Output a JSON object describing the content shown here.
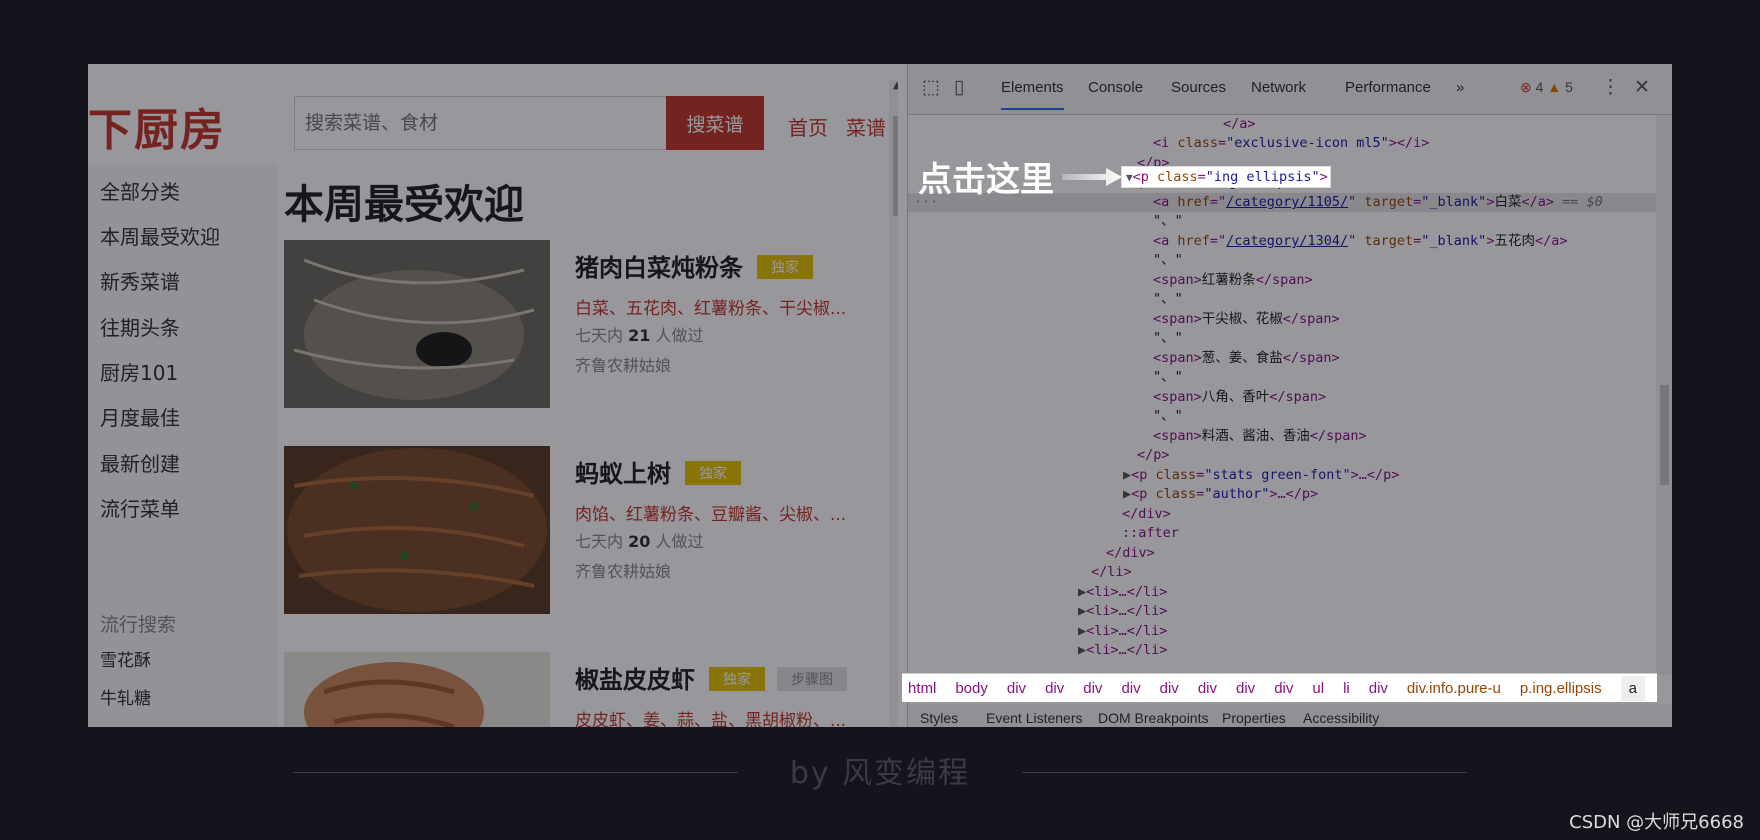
{
  "site": {
    "logo": "下厨房",
    "search_placeholder": "搜索菜谱、食材",
    "search_button": "搜菜谱",
    "nav": [
      "首页",
      "菜谱"
    ]
  },
  "sidebar": {
    "items": [
      "全部分类",
      "本周最受欢迎",
      "新秀菜谱",
      "往期头条",
      "厨房101",
      "月度最佳",
      "最新创建",
      "流行菜单"
    ],
    "popular_title": "流行搜索",
    "popular": [
      "雪花酥",
      "牛轧糖"
    ]
  },
  "main": {
    "title": "本周最受欢迎",
    "recipes": [
      {
        "name": "猪肉白菜炖粉条",
        "badge": "独家",
        "ingredients": "白菜、五花肉、红薯粉条、干尖椒...",
        "stats_prefix": "七天内",
        "stats_count": "21",
        "stats_suffix": "人做过",
        "author": "齐鲁农耕姑娘"
      },
      {
        "name": "蚂蚁上树",
        "badge": "独家",
        "ingredients": "肉馅、红薯粉条、豆瓣酱、尖椒、...",
        "stats_prefix": "七天内",
        "stats_count": "20",
        "stats_suffix": "人做过",
        "author": "齐鲁农耕姑娘"
      },
      {
        "name": "椒盐皮皮虾",
        "badge": "独家",
        "badge2": "步骤图",
        "ingredients": "皮皮虾、姜、蒜、盐、黑胡椒粉、..."
      }
    ]
  },
  "devtools": {
    "tabs": [
      "Elements",
      "Console",
      "Sources",
      "Network",
      "Performance",
      "»"
    ],
    "errors": "4",
    "warnings": "5",
    "dom": {
      "l0": "</a>",
      "l1_tag": "<i ",
      "l1_attr": "class",
      "l1_val": "\"exclusive-icon ml5\"",
      "l1_end": "></i>",
      "l2": "</p>",
      "l3_tag": "<p ",
      "l3_attr": "class",
      "l3_val": "\"ing ellipsis\"",
      "l3_end": ">",
      "l4_attr1": "href",
      "l4_link": "/category/1105/",
      "l4_attr2": "target",
      "l4_val2": "\"_blank\"",
      "l4_text": "白菜",
      "l4_zero": "== $0",
      "sep": "\"、\"",
      "l6_link": "/category/1304/",
      "l6_text": "五花肉",
      "span1": "红薯粉条",
      "span2": "干尖椒、花椒",
      "span3": "葱、姜、食盐",
      "span4": "八角、香叶",
      "span5": "料酒、酱油、香油",
      "stats_val": "\"stats green-font\"",
      "stats_end": ">…</p>",
      "author_val": "\"author\"",
      "author_end": ">…</p>",
      "div_close": "</div>",
      "after": "::after",
      "li_close": "</li>",
      "li_collapsed": "<li>…</li>"
    },
    "breadcrumbs": [
      "html",
      "body",
      "div",
      "div",
      "div",
      "div",
      "div",
      "div",
      "div",
      "div",
      "ul",
      "li",
      "div",
      "div.info.pure-u",
      "p.ing.ellipsis",
      "a"
    ],
    "subtabs": [
      "Styles",
      "Event Listeners",
      "DOM Breakpoints",
      "Properties",
      "Accessibility"
    ]
  },
  "annotation": "点击这里",
  "footer": {
    "by": "by 风变编程",
    "watermark": "CSDN @大师兄6668"
  }
}
